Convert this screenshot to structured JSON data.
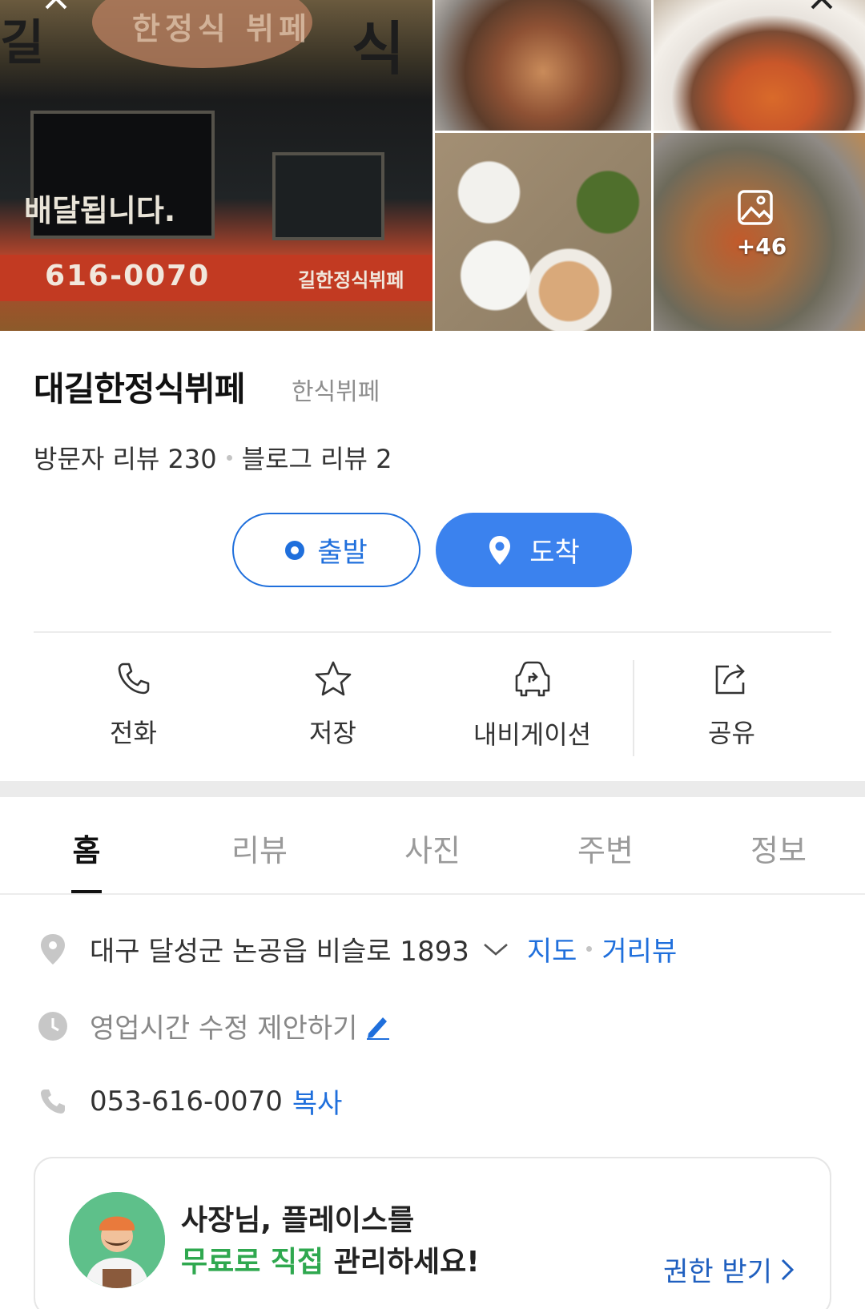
{
  "gallery": {
    "main_photo_texts": {
      "delivery": "배달됩니다.",
      "phone": "616-0070",
      "sign_small": "길한정식뷔페",
      "char_left": "길",
      "char_right": "식",
      "sign": "한정식 뷔페"
    },
    "more_count": "+46"
  },
  "place": {
    "name": "대길한정식뷔페",
    "category": "한식뷔페",
    "visitor_reviews": "방문자 리뷰 230",
    "blog_reviews": "블로그 리뷰 2"
  },
  "route": {
    "depart_label": "출발",
    "arrive_label": "도착",
    "accent": "#3b82ee"
  },
  "actions": [
    {
      "label": "전화",
      "icon": "phone-icon"
    },
    {
      "label": "저장",
      "icon": "star-icon"
    },
    {
      "label": "내비게이션",
      "icon": "car-navigation-icon"
    },
    {
      "label": "공유",
      "icon": "share-icon"
    }
  ],
  "tabs": [
    {
      "label": "홈",
      "active": true
    },
    {
      "label": "리뷰",
      "active": false
    },
    {
      "label": "사진",
      "active": false
    },
    {
      "label": "주변",
      "active": false
    },
    {
      "label": "정보",
      "active": false
    }
  ],
  "info": {
    "address": "대구 달성군 논공읍 비슬로 1893",
    "map_link": "지도",
    "street_view_link": "거리뷰",
    "hours_suggest": "영업시간 수정 제안하기",
    "phone": "053-616-0070",
    "copy_link": "복사"
  },
  "banner": {
    "line1": "사장님, 플레이스를",
    "line2_highlight": "무료로 직접",
    "line2_rest": " 관리하세요!",
    "cta": "권한 받기",
    "highlight_color": "#2fa84f"
  }
}
